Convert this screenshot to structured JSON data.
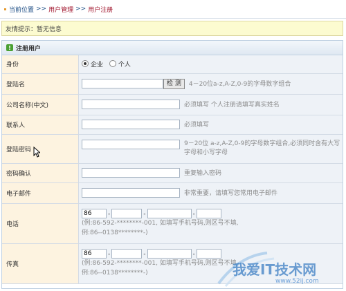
{
  "breadcrumb": {
    "home": "当前位置",
    "sep": ">>",
    "section": "用户管理",
    "current": "用户注册"
  },
  "notice": {
    "label": "友情提示：",
    "text": "暂无信息"
  },
  "panel": {
    "title": "注册用户"
  },
  "form": {
    "identity": {
      "label": "身份",
      "options": [
        "企业",
        "个人"
      ],
      "selected": "企业"
    },
    "username": {
      "label": "登陆名",
      "check_button": "检 测",
      "hint": "4－20位a-z,A-Z,0-9的字母数字组合"
    },
    "company": {
      "label": "公司名称(中文)",
      "hint": "必须填写 个人注册请填写真实姓名"
    },
    "contact": {
      "label": "联系人",
      "hint": "必须填写"
    },
    "password": {
      "label": "登陆密码",
      "hint_line1": "9－20位 a-z,A-Z,0-9的字母数字组合,必须同时含有大写",
      "hint_line2": "字母和小写字母"
    },
    "confirm": {
      "label": "密码确认",
      "hint": "重复输入密码"
    },
    "email": {
      "label": "电子邮件",
      "hint": "非常重要，请填写您常用电子邮件"
    },
    "phone": {
      "label": "电话",
      "country_code": "86",
      "note_line1": "(例:86-592-********-001, 如填写手机号码,则区号不填,",
      "note_line2": "例:86--0138********-)"
    },
    "fax": {
      "label": "传真",
      "country_code": "86",
      "note_line1": "(例:86-592-********-001, 如填写手机号码,则区号不填,",
      "note_line2": "例:86--0138********-)"
    }
  },
  "watermark": {
    "text": "我爱IT技术网",
    "url": "www.52ij.com"
  }
}
